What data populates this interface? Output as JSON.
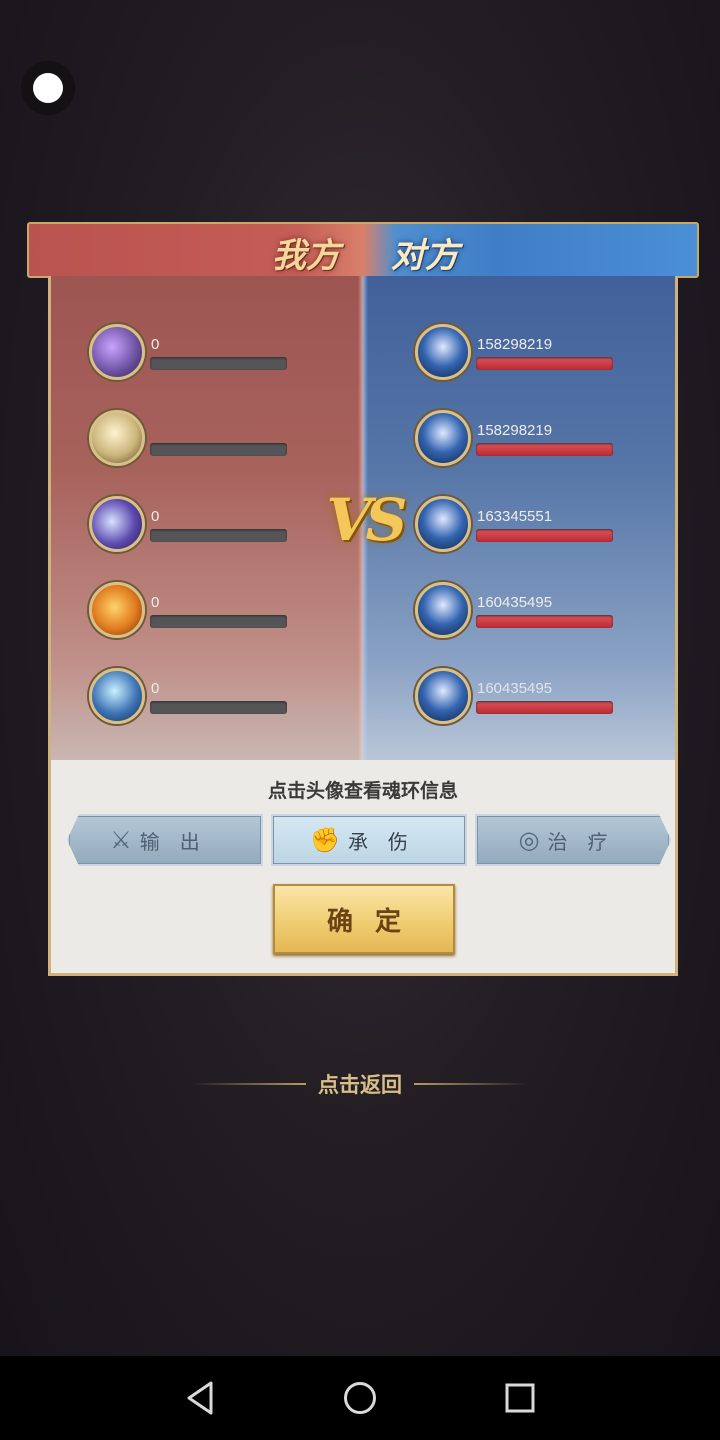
{
  "header": {
    "ally_label": "我方",
    "enemy_label": "对方",
    "vs_label": "VS"
  },
  "ally_team": [
    {
      "value": "0",
      "color": "#6a4f9e",
      "icon": "hero-avatar"
    },
    {
      "value": "",
      "color": "#cbb57a",
      "icon": "hero-avatar"
    },
    {
      "value": "0",
      "color": "#5e4bb0",
      "icon": "hero-avatar"
    },
    {
      "value": "0",
      "color": "#e07c1f",
      "icon": "hero-avatar"
    },
    {
      "value": "0",
      "color": "#3e74b5",
      "icon": "hero-avatar"
    }
  ],
  "enemy_team": [
    {
      "value": "158298219",
      "color": "#3465b0",
      "icon": "hero-avatar"
    },
    {
      "value": "158298219",
      "color": "#3465b0",
      "icon": "hero-avatar"
    },
    {
      "value": "163345551",
      "color": "#3465b0",
      "icon": "hero-avatar"
    },
    {
      "value": "160435495",
      "color": "#3465b0",
      "icon": "hero-avatar"
    },
    {
      "value": "160435495",
      "color": "#3465b0",
      "icon": "hero-avatar"
    }
  ],
  "hint": "点击头像查看魂环信息",
  "tabs": [
    {
      "label": "输出",
      "icon": "sword-icon"
    },
    {
      "label": "承伤",
      "icon": "muscle-icon"
    },
    {
      "label": "治疗",
      "icon": "swirl-icon"
    }
  ],
  "active_tab": "承伤",
  "confirm_label": "确定",
  "back_label": "点击返回",
  "colors": {
    "ally": "#a8625c",
    "enemy": "#4f6fa3",
    "gold": "#cfb37a"
  }
}
